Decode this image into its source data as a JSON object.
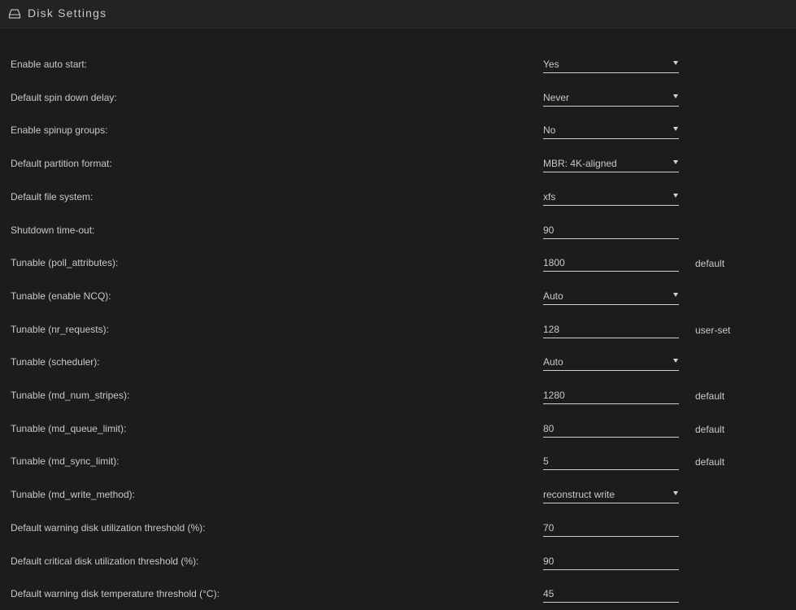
{
  "header": {
    "title": "Disk Settings",
    "icon": "drive-icon"
  },
  "settings": [
    {
      "label": "Enable auto start:",
      "value": "Yes",
      "type": "select",
      "note": ""
    },
    {
      "label": "Default spin down delay:",
      "value": "Never",
      "type": "select",
      "note": ""
    },
    {
      "label": "Enable spinup groups:",
      "value": "No",
      "type": "select",
      "note": ""
    },
    {
      "label": "Default partition format:",
      "value": "MBR: 4K-aligned",
      "type": "select",
      "note": ""
    },
    {
      "label": "Default file system:",
      "value": "xfs",
      "type": "select",
      "note": ""
    },
    {
      "label": "Shutdown time-out:",
      "value": "90",
      "type": "input",
      "note": ""
    },
    {
      "label": "Tunable (poll_attributes):",
      "value": "1800",
      "type": "input",
      "note": "default"
    },
    {
      "label": "Tunable (enable NCQ):",
      "value": "Auto",
      "type": "select",
      "note": ""
    },
    {
      "label": "Tunable (nr_requests):",
      "value": "128",
      "type": "input",
      "note": "user-set"
    },
    {
      "label": "Tunable (scheduler):",
      "value": "Auto",
      "type": "select",
      "note": ""
    },
    {
      "label": "Tunable (md_num_stripes):",
      "value": "1280",
      "type": "input",
      "note": "default"
    },
    {
      "label": "Tunable (md_queue_limit):",
      "value": "80",
      "type": "input",
      "note": "default"
    },
    {
      "label": "Tunable (md_sync_limit):",
      "value": "5",
      "type": "input",
      "note": "default"
    },
    {
      "label": "Tunable (md_write_method):",
      "value": "reconstruct write",
      "type": "select",
      "note": ""
    },
    {
      "label": "Default warning disk utilization threshold (%):",
      "value": "70",
      "type": "input",
      "note": ""
    },
    {
      "label": "Default critical disk utilization threshold (%):",
      "value": "90",
      "type": "input",
      "note": ""
    },
    {
      "label": "Default warning disk temperature threshold (°C):",
      "value": "45",
      "type": "input",
      "note": ""
    }
  ]
}
